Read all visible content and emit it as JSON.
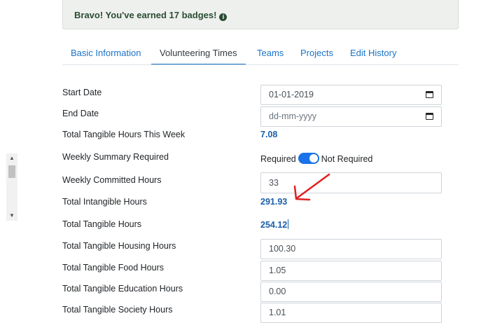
{
  "alert": {
    "text": "Bravo! You've earned 17 badges!",
    "icon": "info-icon"
  },
  "tabs": [
    {
      "label": "Basic Information",
      "active": false
    },
    {
      "label": "Volunteering Times",
      "active": true
    },
    {
      "label": "Teams",
      "active": false
    },
    {
      "label": "Projects",
      "active": false
    },
    {
      "label": "Edit History",
      "active": false
    }
  ],
  "fields": {
    "start_date": {
      "label": "Start Date",
      "value": "01-01-2019"
    },
    "end_date": {
      "label": "End Date",
      "placeholder": "dd-mm-yyyy"
    },
    "tangible_week": {
      "label": "Total Tangible Hours This Week",
      "value": "7.08"
    },
    "weekly_summary": {
      "label": "Weekly Summary Required",
      "on_label": "Required",
      "off_label": "Not Required"
    },
    "committed": {
      "label": "Weekly Committed Hours",
      "value": "33"
    },
    "intangible": {
      "label": "Total Intangible Hours",
      "value": "291.93"
    },
    "tangible": {
      "label": "Total Tangible Hours",
      "value": "254.12"
    },
    "housing": {
      "label": "Total Tangible Housing Hours",
      "value": "100.30"
    },
    "food": {
      "label": "Total Tangible Food Hours",
      "value": "1.05"
    },
    "education": {
      "label": "Total Tangible Education Hours",
      "value": "0.00"
    },
    "society": {
      "label": "Total Tangible Society Hours",
      "value": "1.01"
    }
  },
  "colors": {
    "accent": "#1a73c8",
    "annotation": "#e02020"
  }
}
